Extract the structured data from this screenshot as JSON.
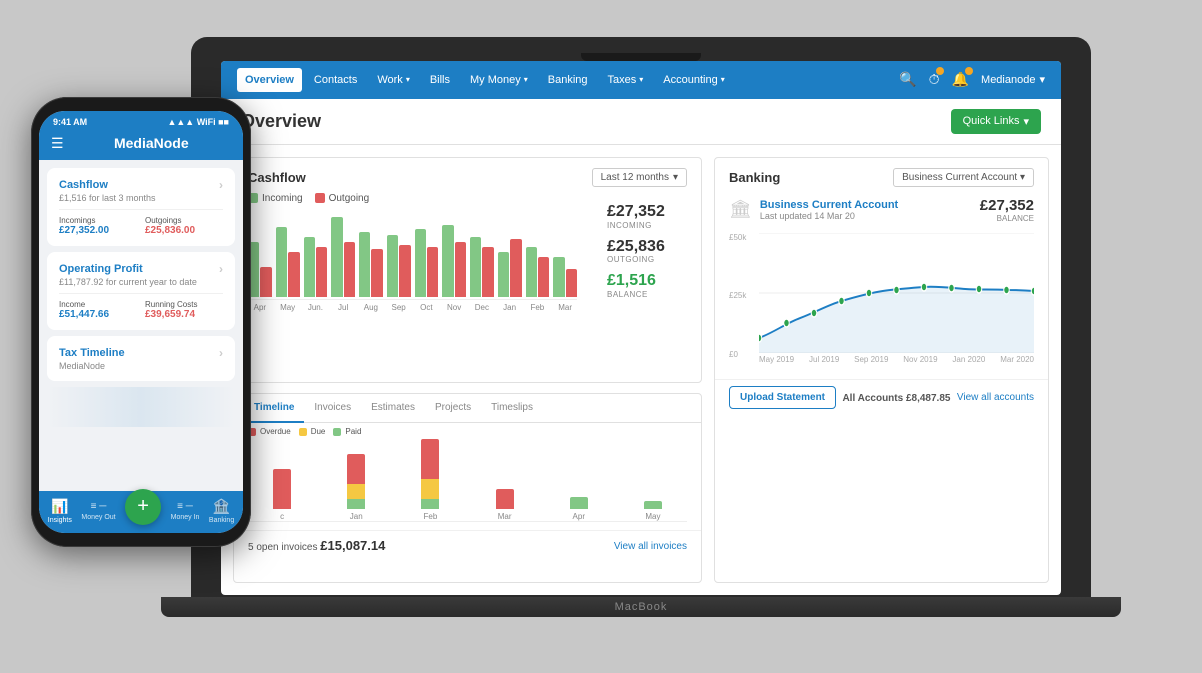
{
  "background": "#c8c8c8",
  "laptop": {
    "brand": "MacBook",
    "nav": {
      "items": [
        {
          "label": "Overview",
          "active": true
        },
        {
          "label": "Contacts",
          "active": false
        },
        {
          "label": "Work",
          "hasChevron": true,
          "active": false
        },
        {
          "label": "Bills",
          "active": false
        },
        {
          "label": "My Money",
          "hasChevron": true,
          "active": false
        },
        {
          "label": "Banking",
          "active": false
        },
        {
          "label": "Taxes",
          "hasChevron": true,
          "active": false
        },
        {
          "label": "Accounting",
          "hasChevron": true,
          "active": false
        }
      ],
      "user": "Medianode"
    },
    "page": {
      "title": "Overview",
      "quickLinks": "Quick Links"
    },
    "cashflow": {
      "title": "Cashflow",
      "period": "Last 12 months",
      "incoming": "£27,352",
      "incoming_label": "INCOMING",
      "outgoing": "£25,836",
      "outgoing_label": "OUTGOING",
      "balance": "£1,516",
      "balance_label": "BALANCE",
      "legend_incoming": "Incoming",
      "legend_outgoing": "Outgoing",
      "months": [
        "Apr",
        "May",
        "Jun.",
        "Jul",
        "Aug",
        "Sep",
        "Oct",
        "Nov",
        "Dec",
        "Jan",
        "Feb",
        "Mar"
      ],
      "bars": [
        {
          "in": 55,
          "out": 30
        },
        {
          "in": 70,
          "out": 45
        },
        {
          "in": 60,
          "out": 50
        },
        {
          "in": 80,
          "out": 55
        },
        {
          "in": 65,
          "out": 48
        },
        {
          "in": 62,
          "out": 52
        },
        {
          "in": 68,
          "out": 50
        },
        {
          "in": 72,
          "out": 55
        },
        {
          "in": 60,
          "out": 50
        },
        {
          "in": 45,
          "out": 58
        },
        {
          "in": 50,
          "out": 40
        },
        {
          "in": 40,
          "out": 28
        }
      ]
    },
    "invoices": {
      "tabs": [
        "Timeline",
        "Invoices",
        "Estimates",
        "Projects",
        "Timeslips"
      ],
      "active_tab": "Timeline",
      "legend": {
        "overdue": "Overdue",
        "due": "Due",
        "paid": "Paid"
      },
      "months": [
        "c",
        "Jan",
        "Feb",
        "Mar",
        "Apr",
        "May"
      ],
      "open_count": 5,
      "total": "£15,087.14",
      "view_all": "View all invoices"
    },
    "banking": {
      "title": "Banking",
      "account_name": "Business Current Account",
      "account_filter": "Business Current Account",
      "last_updated": "Last updated 14 Mar 20",
      "balance": "£27,352",
      "balance_label": "BALANCE",
      "all_accounts_label": "All Accounts",
      "all_accounts_value": "£8,487.85",
      "view_all": "View all accounts",
      "upload": "Upload Statement",
      "y_labels": [
        "£50k",
        "£25k",
        "£0"
      ],
      "x_labels": [
        "May 2019",
        "Jul 2019",
        "Sep 2019",
        "Nov 2019",
        "Jan 2020",
        "Mar 2020"
      ]
    }
  },
  "phone": {
    "time": "9:41 AM",
    "app_name": "MediaNode",
    "cashflow": {
      "title": "Cashflow",
      "subtitle": "£1,516 for last 3 months",
      "incomings_label": "Incomings",
      "incomings_value": "£27,352.00",
      "outgoings_label": "Outgoings",
      "outgoings_value": "£25,836.00"
    },
    "operating_profit": {
      "title": "Operating Profit",
      "subtitle": "£11,787.92 for current year to date",
      "income_label": "Income",
      "income_value": "£51,447.66",
      "costs_label": "Running Costs",
      "costs_value": "£39,659.74"
    },
    "tax_timeline": {
      "title": "Tax Timeline",
      "subtitle": "MediaNode"
    },
    "bottom_nav": [
      {
        "label": "Insights",
        "icon": "📊",
        "active": true
      },
      {
        "label": "Money Out",
        "icon": "≡",
        "active": false
      },
      {
        "label": "FAB",
        "icon": "+"
      },
      {
        "label": "Money In",
        "icon": "≡",
        "active": false
      },
      {
        "label": "Banking",
        "icon": "🏦",
        "active": false
      }
    ]
  }
}
